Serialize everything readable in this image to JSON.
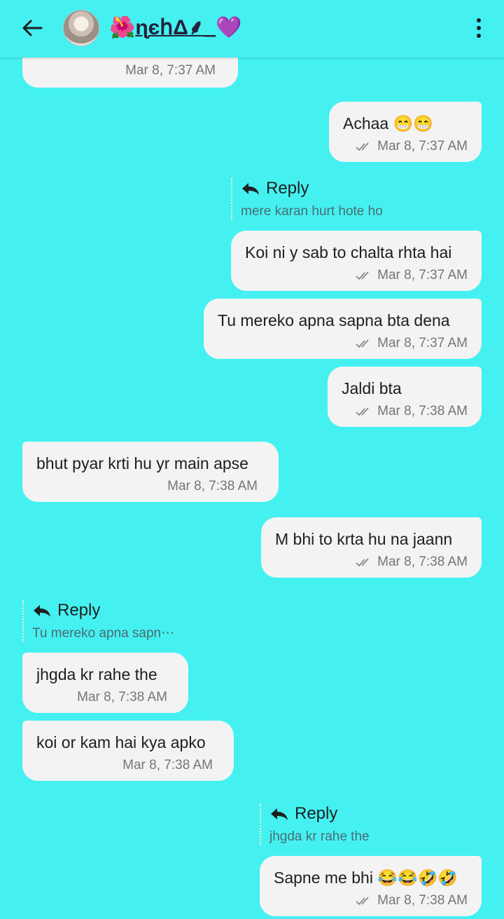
{
  "header": {
    "title_prefix": "🌺",
    "title_name": "ɳєհΔ⸙_",
    "title_suffix": "💜"
  },
  "colors": {
    "background": "#44f1f0",
    "bubble": "#f3f3f4",
    "meta": "#757575"
  },
  "messages": [
    {
      "meta": "Mar 8, 7:37 AM"
    },
    {
      "text": "Achaa 😁😁",
      "meta": "Mar 8, 7:37 AM"
    },
    {
      "reply_label": "Reply",
      "reply_quote": "mere karan hurt hote ho"
    },
    {
      "text": "Koi ni y sab to chalta rhta hai",
      "meta": "Mar 8, 7:37 AM"
    },
    {
      "text": "Tu mereko apna sapna bta dena",
      "meta": "Mar 8, 7:37 AM"
    },
    {
      "text": "Jaldi bta",
      "meta": "Mar 8, 7:38 AM"
    },
    {
      "text": "bhut pyar krti hu yr main apse",
      "meta": "Mar 8, 7:38 AM"
    },
    {
      "text": "M bhi to krta hu na jaann",
      "meta": "Mar 8, 7:38 AM"
    },
    {
      "reply_label": "Reply",
      "reply_quote": "Tu mereko apna sapn⋯"
    },
    {
      "text": "jhgda kr rahe the",
      "meta": "Mar 8, 7:38 AM"
    },
    {
      "text": "koi or kam hai kya apko",
      "meta": "Mar 8, 7:38 AM"
    },
    {
      "reply_label": "Reply",
      "reply_quote": "jhgda kr rahe the"
    },
    {
      "text": "Sapne me bhi 😂😂🤣🤣",
      "meta": "Mar 8, 7:38 AM"
    }
  ]
}
